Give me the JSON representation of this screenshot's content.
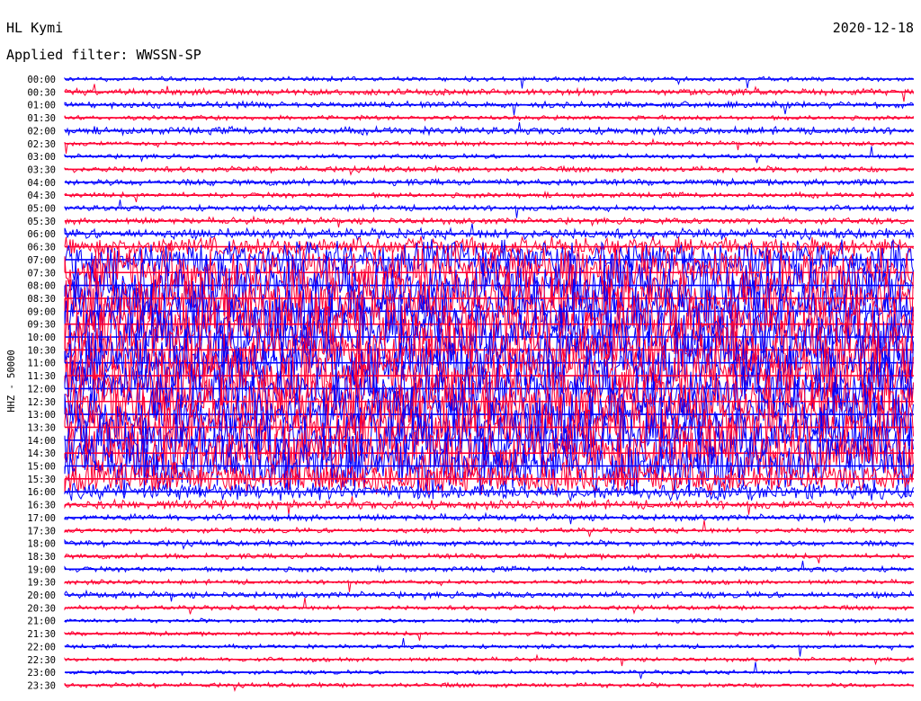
{
  "header": {
    "station": "HL Kymi",
    "date": "2020-12-18",
    "filter": "Applied filter: WWSSN-SP"
  },
  "colors": {
    "blue": "#0000ff",
    "red": "#ff0033"
  },
  "chart_data": {
    "type": "line",
    "ylabel": "HHZ - 50000",
    "grid": false,
    "legend": "none",
    "rows": [
      {
        "label": "00:00",
        "color": "blue",
        "activity": 0.05
      },
      {
        "label": "00:30",
        "color": "red",
        "activity": 0.08
      },
      {
        "label": "01:00",
        "color": "blue",
        "activity": 0.08
      },
      {
        "label": "01:30",
        "color": "red",
        "activity": 0.05
      },
      {
        "label": "02:00",
        "color": "blue",
        "activity": 0.1
      },
      {
        "label": "02:30",
        "color": "red",
        "activity": 0.05
      },
      {
        "label": "03:00",
        "color": "blue",
        "activity": 0.05
      },
      {
        "label": "03:30",
        "color": "red",
        "activity": 0.07
      },
      {
        "label": "04:00",
        "color": "blue",
        "activity": 0.08
      },
      {
        "label": "04:30",
        "color": "red",
        "activity": 0.06
      },
      {
        "label": "05:00",
        "color": "blue",
        "activity": 0.07
      },
      {
        "label": "05:30",
        "color": "red",
        "activity": 0.08
      },
      {
        "label": "06:00",
        "color": "blue",
        "activity": 0.15
      },
      {
        "label": "06:30",
        "color": "red",
        "activity": 0.3
      },
      {
        "label": "07:00",
        "color": "blue",
        "activity": 0.6
      },
      {
        "label": "07:30",
        "color": "red",
        "activity": 0.9
      },
      {
        "label": "08:00",
        "color": "blue",
        "activity": 1.0
      },
      {
        "label": "08:30",
        "color": "red",
        "activity": 1.0
      },
      {
        "label": "09:00",
        "color": "blue",
        "activity": 1.0
      },
      {
        "label": "09:30",
        "color": "red",
        "activity": 1.0
      },
      {
        "label": "10:00",
        "color": "blue",
        "activity": 1.0
      },
      {
        "label": "10:30",
        "color": "red",
        "activity": 1.0
      },
      {
        "label": "11:00",
        "color": "blue",
        "activity": 1.0
      },
      {
        "label": "11:30",
        "color": "red",
        "activity": 1.0
      },
      {
        "label": "12:00",
        "color": "blue",
        "activity": 1.0
      },
      {
        "label": "12:30",
        "color": "red",
        "activity": 1.0
      },
      {
        "label": "13:00",
        "color": "blue",
        "activity": 1.0
      },
      {
        "label": "13:30",
        "color": "red",
        "activity": 1.0
      },
      {
        "label": "14:00",
        "color": "blue",
        "activity": 1.0
      },
      {
        "label": "14:30",
        "color": "red",
        "activity": 1.0
      },
      {
        "label": "15:00",
        "color": "blue",
        "activity": 0.95
      },
      {
        "label": "15:30",
        "color": "red",
        "activity": 0.5
      },
      {
        "label": "16:00",
        "color": "blue",
        "activity": 0.25
      },
      {
        "label": "16:30",
        "color": "red",
        "activity": 0.12
      },
      {
        "label": "17:00",
        "color": "blue",
        "activity": 0.08
      },
      {
        "label": "17:30",
        "color": "red",
        "activity": 0.06
      },
      {
        "label": "18:00",
        "color": "blue",
        "activity": 0.07
      },
      {
        "label": "18:30",
        "color": "red",
        "activity": 0.06
      },
      {
        "label": "19:00",
        "color": "blue",
        "activity": 0.06
      },
      {
        "label": "19:30",
        "color": "red",
        "activity": 0.05
      },
      {
        "label": "20:00",
        "color": "blue",
        "activity": 0.08
      },
      {
        "label": "20:30",
        "color": "red",
        "activity": 0.05
      },
      {
        "label": "21:00",
        "color": "blue",
        "activity": 0.04
      },
      {
        "label": "21:30",
        "color": "red",
        "activity": 0.04
      },
      {
        "label": "22:00",
        "color": "blue",
        "activity": 0.04
      },
      {
        "label": "22:30",
        "color": "red",
        "activity": 0.04
      },
      {
        "label": "23:00",
        "color": "blue",
        "activity": 0.04
      },
      {
        "label": "23:30",
        "color": "red",
        "activity": 0.05
      }
    ]
  }
}
